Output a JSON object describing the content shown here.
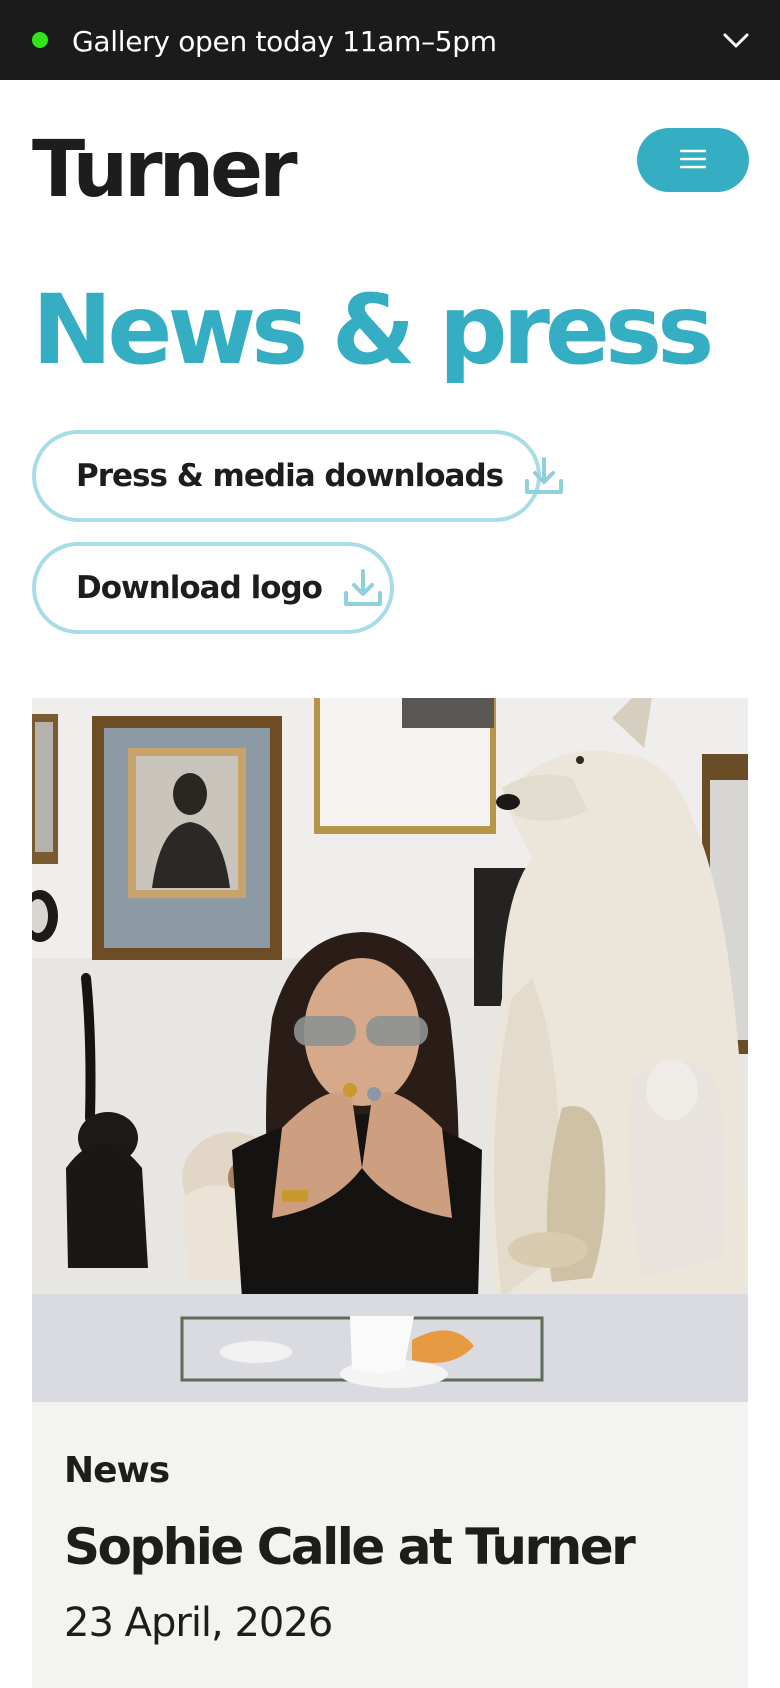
{
  "banner": {
    "status_text": "Gallery open today 11am–5pm",
    "status_color": "#2ee61a",
    "toggle_icon": "chevron-down-icon"
  },
  "header": {
    "logo_text": "Turner",
    "menu_icon": "hamburger-icon",
    "accent_color": "#35adc3"
  },
  "main": {
    "title": "News & press",
    "buttons": [
      {
        "label": "Press & media downloads",
        "icon": "download-icon"
      },
      {
        "label": "Download logo",
        "icon": "download-icon"
      }
    ],
    "featured": {
      "category": "News",
      "headline": "Sophie Calle at Turner",
      "date": "23 April, 2026"
    }
  }
}
